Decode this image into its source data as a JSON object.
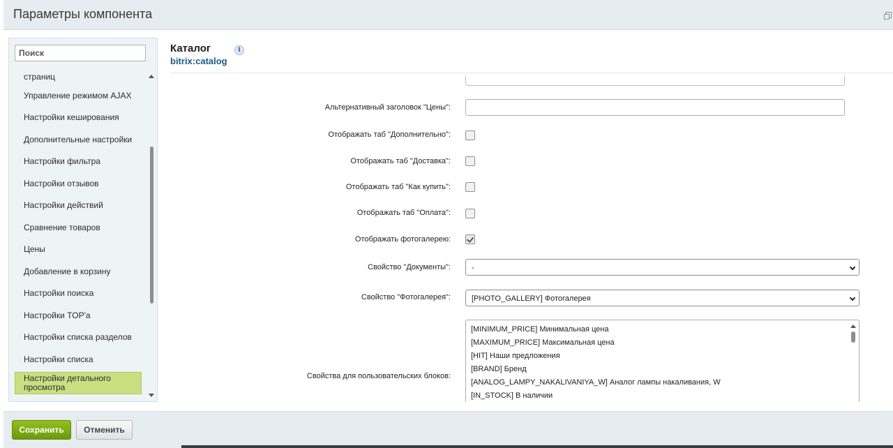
{
  "dialog": {
    "title": "Параметры компонента"
  },
  "sidebar": {
    "search_placeholder": "Поиск",
    "items": [
      {
        "label": "страниц"
      },
      {
        "label": "Управление режимом AJAX"
      },
      {
        "label": "Настройки кеширования"
      },
      {
        "label": "Дополнительные настройки"
      },
      {
        "label": "Настройки фильтра"
      },
      {
        "label": "Настройки отзывов"
      },
      {
        "label": "Настройки действий"
      },
      {
        "label": "Сравнение товаров"
      },
      {
        "label": "Цены"
      },
      {
        "label": "Добавление в корзину"
      },
      {
        "label": "Настройки поиска"
      },
      {
        "label": "Настройки TOP'а"
      },
      {
        "label": "Настройки списка разделов"
      },
      {
        "label": "Настройки списка"
      },
      {
        "label": "Настройки детального просмотра"
      }
    ]
  },
  "component": {
    "title": "Каталог",
    "code": "bitrix:catalog",
    "info_icon": "i"
  },
  "form": {
    "alt_price_title_label": "Альтернативный заголовок \"Цены\":",
    "alt_price_title_value": "",
    "show_tab_additional_label": "Отображать таб \"Дополнительно\":",
    "show_tab_additional_checked": false,
    "show_tab_delivery_label": "Отображать таб \"Доставка\":",
    "show_tab_delivery_checked": false,
    "show_tab_howtobuy_label": "Отображать таб \"Как купить\":",
    "show_tab_howtobuy_checked": false,
    "show_tab_payment_label": "Отображать таб \"Оплата\":",
    "show_tab_payment_checked": false,
    "show_gallery_label": "Отображать фотогалерею:",
    "show_gallery_checked": true,
    "docs_property_label": "Свойство \"Документы\":",
    "docs_property_value": "-",
    "gallery_property_label": "Свойство \"Фотогалерея\":",
    "gallery_property_value": "[PHOTO_GALLERY] Фотогалерея",
    "custom_blocks_label": "Свойства для пользовательских блоков:",
    "custom_blocks_options": [
      "[MINIMUM_PRICE] Минимальная цена",
      "[MAXIMUM_PRICE] Максимальная цена",
      "[HIT] Наши предложения",
      "[BRAND] Бренд",
      "[ANALOG_LAMPY_NAKALIVANIYA_W] Аналог лампы накаливания, W",
      "[IN_STOCK] В наличии"
    ]
  },
  "footer": {
    "save_label": "Сохранить",
    "cancel_label": "Отменить"
  },
  "colors": {
    "accent_green": "#7aab12",
    "active_nav": "#c9df82",
    "link_blue": "#1c5a87"
  }
}
